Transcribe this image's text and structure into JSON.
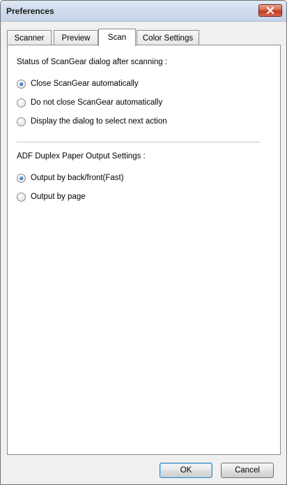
{
  "window": {
    "title": "Preferences"
  },
  "tabs": [
    {
      "label": "Scanner",
      "active": false
    },
    {
      "label": "Preview",
      "active": false
    },
    {
      "label": "Scan",
      "active": true
    },
    {
      "label": "Color Settings",
      "active": false
    }
  ],
  "scan": {
    "status_group": {
      "label": "Status of ScanGear dialog after scanning :",
      "options": [
        {
          "label": "Close ScanGear automatically",
          "checked": true
        },
        {
          "label": "Do not close ScanGear automatically",
          "checked": false
        },
        {
          "label": "Display the dialog to select next action",
          "checked": false
        }
      ]
    },
    "adf_group": {
      "label": "ADF Duplex Paper Output Settings :",
      "options": [
        {
          "label": "Output by back/front(Fast)",
          "checked": true
        },
        {
          "label": "Output by page",
          "checked": false
        }
      ]
    }
  },
  "buttons": {
    "ok": "OK",
    "cancel": "Cancel"
  },
  "icons": {
    "close": "close-icon"
  },
  "colors": {
    "close_button": "#c8432a",
    "radio_selected": "#1c5fb0",
    "title_bar": "#cfdcec"
  }
}
